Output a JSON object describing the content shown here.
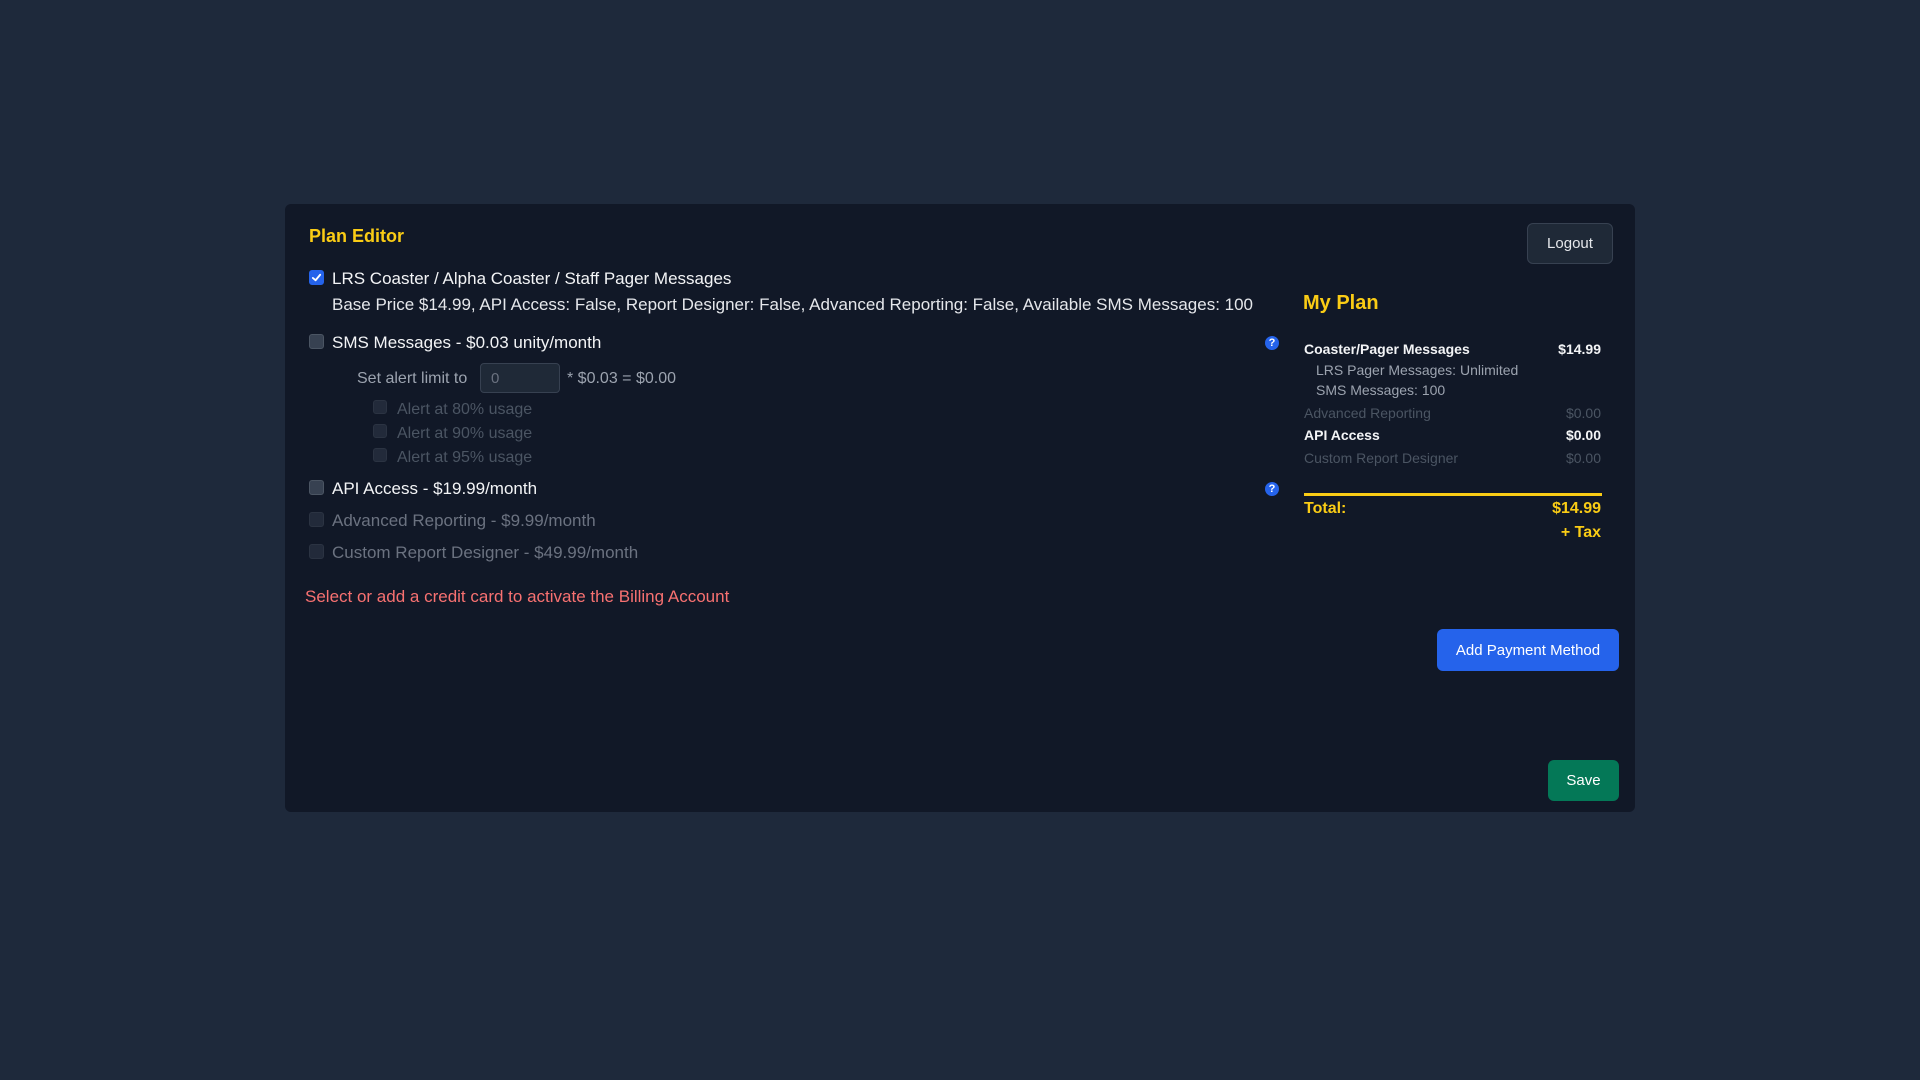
{
  "editor": {
    "title": "Plan Editor",
    "logout_label": "Logout",
    "base_plan": {
      "label": "LRS Coaster / Alpha Coaster / Staff Pager Messages",
      "checked": true,
      "description": "Base Price $14.99, API Access: False, Report Designer: False, Advanced Reporting: False, Available SMS Messages: 100"
    },
    "sms": {
      "label": "SMS Messages - $0.03 unity/month",
      "checked": false,
      "alert_prefix": "Set alert limit to",
      "alert_value": "",
      "alert_placeholder": "0",
      "alert_suffix": "* $0.03 = $0.00",
      "alerts": [
        {
          "label": "Alert at 80% usage",
          "checked": false
        },
        {
          "label": "Alert at 90% usage",
          "checked": false
        },
        {
          "label": "Alert at 95% usage",
          "checked": false
        }
      ]
    },
    "api": {
      "label": "API Access - $19.99/month",
      "checked": false
    },
    "advanced_reporting": {
      "label": "Advanced Reporting - $9.99/month",
      "checked": false,
      "disabled": true
    },
    "report_designer": {
      "label": "Custom Report Designer - $49.99/month",
      "checked": false,
      "disabled": true
    },
    "help_icon_glyph": "?",
    "error_message": "Select or add a credit card to activate the Billing Account",
    "add_payment_label": "Add Payment Method",
    "save_label": "Save"
  },
  "my_plan": {
    "title": "My Plan",
    "base": {
      "label": "Coaster/Pager Messages",
      "price": "$14.99"
    },
    "base_details": [
      "LRS Pager Messages: Unlimited",
      "SMS Messages: 100"
    ],
    "advanced_reporting": {
      "label": "Advanced Reporting",
      "price": "$0.00"
    },
    "api_access": {
      "label": "API Access",
      "price": "$0.00"
    },
    "report_designer": {
      "label": "Custom Report Designer",
      "price": "$0.00"
    },
    "total_label": "Total:",
    "total_value": "$14.99",
    "tax_note": "+ Tax"
  },
  "colors": {
    "page_bg": "#1e293b",
    "panel_bg": "#111827",
    "accent_yellow": "#facc15",
    "primary_blue": "#2563eb",
    "save_green": "#047857",
    "error_red": "#f87171"
  },
  "icons": {
    "checkbox_check": "check-icon",
    "help": "question-circle-icon"
  }
}
